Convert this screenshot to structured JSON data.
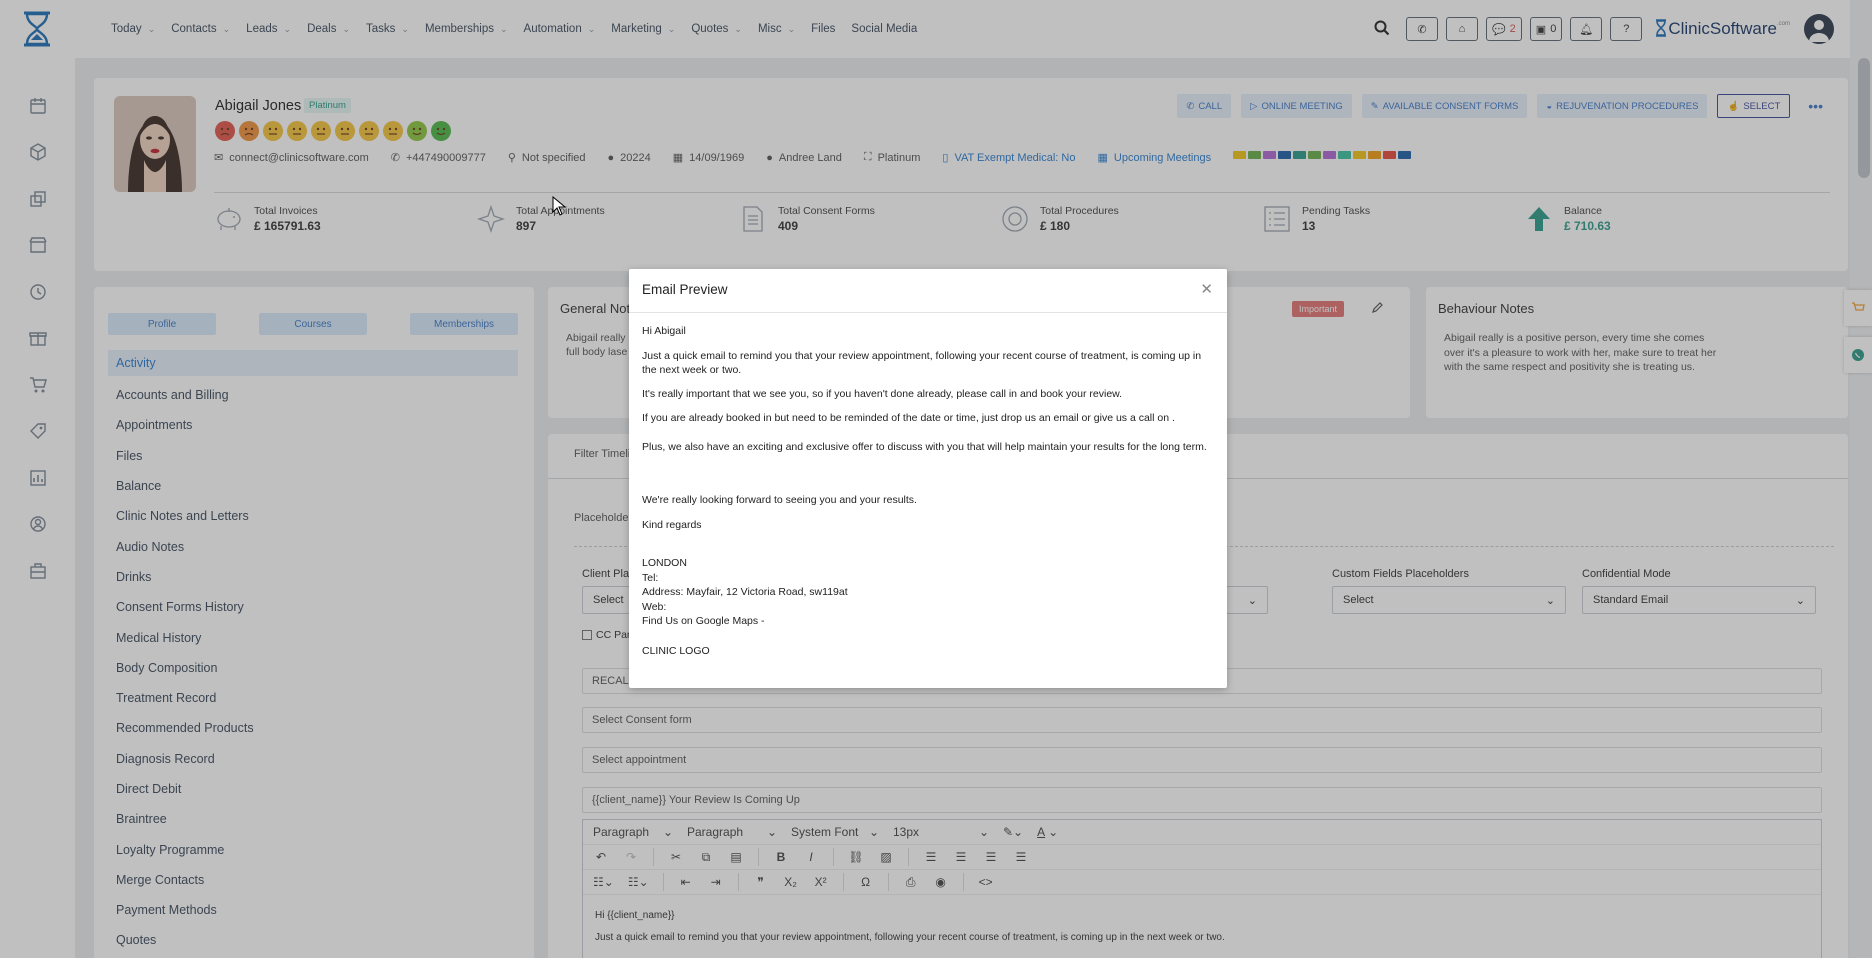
{
  "nav": {
    "items": [
      "Today",
      "Contacts",
      "Leads",
      "Deals",
      "Tasks",
      "Memberships",
      "Automation",
      "Marketing",
      "Quotes",
      "Misc",
      "Files",
      "Social Media"
    ],
    "has_dropdown": [
      true,
      true,
      true,
      true,
      true,
      true,
      true,
      true,
      true,
      true,
      false,
      false
    ],
    "messages_count": "2",
    "cart_count": "0",
    "brand": "ClinicSoftware",
    "brand_sub": ".com"
  },
  "profile": {
    "name": "Abigail Jones",
    "tier_badge": "Platinum",
    "email": "connect@clinicsoftware.com",
    "phone": "+447490009777",
    "gender": "Not specified",
    "client_id": "20224",
    "dob": "14/09/1969",
    "staff": "Andree Land",
    "membership": "Platinum",
    "vat": "VAT Exempt Medical: No",
    "upcoming": "Upcoming Meetings",
    "swatch_colors": [
      "#f0c419",
      "#6ab04c",
      "#b06ad4",
      "#1e5fa8",
      "#2d9b8a",
      "#6ab04c",
      "#b06ad4",
      "#3cc3a0",
      "#f0c419",
      "#f39c12",
      "#e74c3c",
      "#1e5fa8"
    ],
    "emoji_colors": [
      "#e2574c",
      "#f0923c",
      "#f5c33b",
      "#f5c33b",
      "#f5c33b",
      "#f5c33b",
      "#f5c33b",
      "#f5c33b",
      "#8cc63e",
      "#4db848"
    ]
  },
  "stats": [
    {
      "label": "Total Invoices",
      "value": "£ 165791.63",
      "icon": "piggy-bank-icon"
    },
    {
      "label": "Total Appointments",
      "value": "897",
      "icon": "sparkle-icon"
    },
    {
      "label": "Total Consent Forms",
      "value": "409",
      "icon": "document-icon"
    },
    {
      "label": "Total Procedures",
      "value": "£ 180",
      "icon": "lifebuoy-icon"
    },
    {
      "label": "Pending Tasks",
      "value": "13",
      "icon": "checklist-icon"
    },
    {
      "label": "Balance",
      "value": "£ 710.63",
      "icon": "arrow-up-icon"
    }
  ],
  "actions": {
    "call": "CALL",
    "online_meeting": "ONLINE MEETING",
    "consent": "AVAILABLE CONSENT FORMS",
    "rejuvenation": "REJUVENATION PROCEDURES",
    "select": "SELECT"
  },
  "left": {
    "tabs": [
      "Profile",
      "Courses",
      "Memberships"
    ],
    "nav": [
      "Activity",
      "Accounts and Billing",
      "Appointments",
      "Files",
      "Balance",
      "Clinic Notes and Letters",
      "Audio Notes",
      "Drinks",
      "Consent Forms History",
      "Medical History",
      "Body Composition",
      "Treatment Record",
      "Recommended Products",
      "Diagnosis Record",
      "Direct Debit",
      "Braintree",
      "Loyalty Programme",
      "Merge Contacts",
      "Payment Methods",
      "Quotes"
    ]
  },
  "general_notes": {
    "title": "General Not",
    "text_line1": "Abigail really",
    "text_line2": "full body lase",
    "badge": "Important"
  },
  "behaviour_notes": {
    "title": "Behaviour Notes",
    "text": "Abigail really is a positive person, every time she comes over it's a pleasure to work with her, make sure to treat her with the same respect and positivity she is treating us."
  },
  "main": {
    "filter": "Filter Timeli",
    "placeholders": "Placeholde",
    "client_placeholder_label": "Client Pla",
    "client_placeholder_value": "Select",
    "custom_fields_label": "Custom Fields Placeholders",
    "custom_fields_value": "Select",
    "confidential_label": "Confidential Mode",
    "confidential_value": "Standard Email",
    "cc": "CC Par",
    "recall": "RECALL",
    "consent": "Select Consent form",
    "appointment": "Select appointment",
    "subject": "{{client_name}} Your Review Is Coming Up",
    "editor": {
      "block1": "Paragraph",
      "block2": "Paragraph",
      "font": "System Font",
      "size": "13px",
      "line1": "Hi {{client_name}}",
      "line2": "Just a quick email to remind you that your review appointment, following your recent course of treatment, is coming up in the next week or two."
    }
  },
  "modal": {
    "title": "Email Preview",
    "greeting": "Hi Abigail",
    "p1": "Just a quick email to remind you that your review appointment, following your recent course of treatment, is coming up in the next week or two.",
    "p2": "It's really important that we see you, so if you haven't done already, please call in and book your review.",
    "p3": "If you are already booked in but need to be reminded of the date or time, just drop us an email or give us a call on .",
    "p4": "Plus, we also have an exciting and exclusive offer to discuss with you that will help maintain your results for the long term.",
    "p5": "We're really looking forward to seeing you and your results.",
    "p6": "Kind regards",
    "sig_city": "LONDON",
    "sig_tel": "Tel:",
    "sig_addr": "Address: Mayfair, 12 Victoria Road, sw119at",
    "sig_web": "Web:",
    "sig_maps": "Find Us on Google Maps -",
    "sig_logo": "CLINIC LOGO"
  }
}
